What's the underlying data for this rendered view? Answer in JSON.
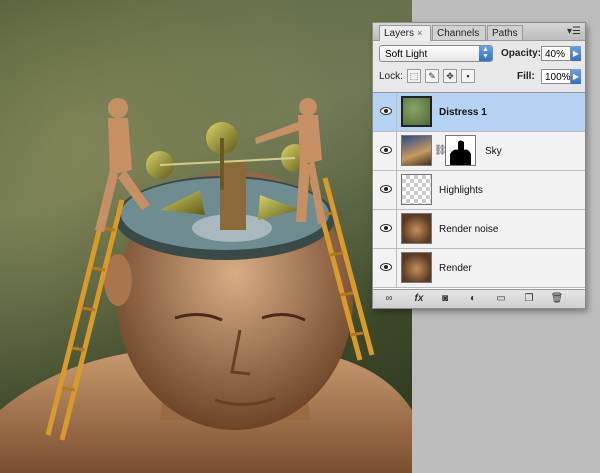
{
  "palette": {
    "tabs": [
      {
        "label": "Layers",
        "close": "×",
        "active": true
      },
      {
        "label": "Channels",
        "active": false
      },
      {
        "label": "Paths",
        "active": false
      }
    ],
    "menu_icon": "menu-icon",
    "blend_mode": "Soft Light",
    "opacity_label": "Opacity:",
    "opacity_value": "40%",
    "lock_label": "Lock:",
    "lock_icons": [
      "lock-transparency-icon",
      "lock-image-icon",
      "lock-position-icon",
      "lock-all-icon"
    ],
    "fill_label": "Fill:",
    "fill_value": "100%",
    "layers": [
      {
        "name": "Distress 1",
        "selected": true,
        "visible": true,
        "thumb": "green-texture",
        "mask": false
      },
      {
        "name": "Sky",
        "selected": false,
        "visible": true,
        "thumb": "sky",
        "mask": true
      },
      {
        "name": "Highlights",
        "selected": false,
        "visible": true,
        "thumb": "transparent",
        "mask": false
      },
      {
        "name": "Render noise",
        "selected": false,
        "visible": true,
        "thumb": "render",
        "mask": false
      },
      {
        "name": "Render",
        "selected": false,
        "visible": true,
        "thumb": "render",
        "mask": false
      }
    ],
    "bottom_icons": [
      "link-layers-icon",
      "fx-icon",
      "add-mask-icon",
      "adjustment-layer-icon",
      "new-group-icon",
      "new-layer-icon",
      "trash-icon"
    ]
  },
  "colors": {
    "selected_row": "#b6d2f2",
    "accent_blue": "#2f6fcf"
  }
}
